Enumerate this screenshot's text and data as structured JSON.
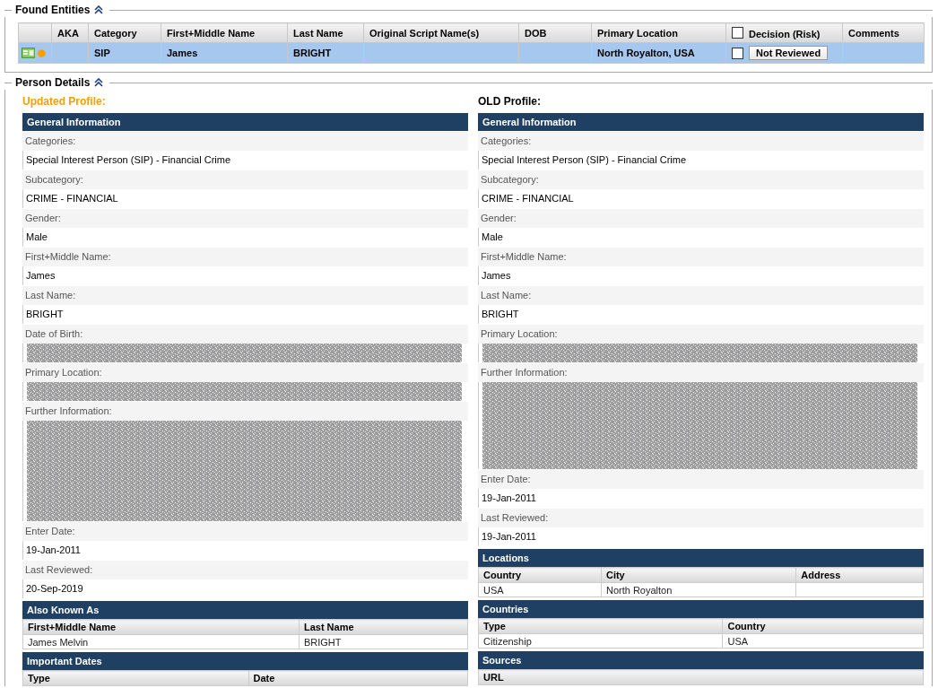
{
  "found_entities": {
    "title": "Found Entities",
    "columns": [
      "AKA",
      "Category",
      "First+Middle Name",
      "Last Name",
      "Original Script Name(s)",
      "DOB",
      "Primary Location",
      "Decision (Risk)",
      "Comments"
    ],
    "header_checkbox": {
      "checked": false
    },
    "rows": [
      {
        "selected": true,
        "category": "SIP",
        "first_middle_name": "James",
        "last_name": "BRIGHT",
        "primary_location": "North Royalton, USA",
        "decision_checkbox": {
          "checked": false
        },
        "decision": "Not Reviewed"
      }
    ]
  },
  "person_details": {
    "title": "Person Details",
    "profiles": [
      {
        "kind": "updated",
        "heading": "Updated Profile:",
        "sections": [
          {
            "kind": "fields",
            "title": "General Information",
            "fields": [
              {
                "kind": "text",
                "label": "Categories:",
                "value": "Special Interest Person (SIP) - Financial Crime"
              },
              {
                "kind": "text",
                "label": "Subcategory:",
                "value": "CRIME - FINANCIAL"
              },
              {
                "kind": "text",
                "label": "Gender:",
                "value": "Male"
              },
              {
                "kind": "text",
                "label": "First+Middle Name:",
                "value": "James"
              },
              {
                "kind": "text",
                "label": "Last Name:",
                "value": "BRIGHT"
              },
              {
                "kind": "redacted",
                "label": "Date of Birth:"
              },
              {
                "kind": "redacted",
                "label": "Primary Location:"
              },
              {
                "kind": "redacted_tall",
                "label": "Further Information:"
              },
              {
                "kind": "text",
                "label": "Enter Date:",
                "value": "19-Jan-2011"
              },
              {
                "kind": "text",
                "label": "Last Reviewed:",
                "value": "20-Sep-2019"
              }
            ]
          },
          {
            "kind": "table",
            "title": "Also Known As",
            "columns": [
              "First+Middle Name",
              "Last Name"
            ],
            "rows": [
              [
                "James Melvin",
                "BRIGHT"
              ]
            ]
          },
          {
            "kind": "table",
            "title": "Important Dates",
            "columns": [
              "Type",
              "Date"
            ]
          }
        ]
      },
      {
        "kind": "old",
        "heading": "OLD Profile:",
        "sections": [
          {
            "kind": "fields",
            "title": "General Information",
            "fields": [
              {
                "kind": "text",
                "label": "Categories:",
                "value": "Special Interest Person (SIP) - Financial Crime"
              },
              {
                "kind": "text",
                "label": "Subcategory:",
                "value": "CRIME - FINANCIAL"
              },
              {
                "kind": "text",
                "label": "Gender:",
                "value": "Male"
              },
              {
                "kind": "text",
                "label": "First+Middle Name:",
                "value": "James"
              },
              {
                "kind": "text",
                "label": "Last Name:",
                "value": "BRIGHT"
              },
              {
                "kind": "redacted",
                "label": "Primary Location:"
              },
              {
                "kind": "redacted_block",
                "label": "Further Information:"
              },
              {
                "kind": "text",
                "label": "Enter Date:",
                "value": "19-Jan-2011"
              },
              {
                "kind": "text",
                "label": "Last Reviewed:",
                "value": "19-Jan-2011"
              }
            ]
          },
          {
            "kind": "table",
            "title": "Locations",
            "columns": [
              "Country",
              "City",
              "Address"
            ],
            "rows": [
              [
                "USA",
                "North Royalton",
                ""
              ]
            ]
          },
          {
            "kind": "table",
            "title": "Countries",
            "columns": [
              "Type",
              "Country"
            ],
            "rows": [
              [
                "Citizenship",
                "USA"
              ]
            ]
          },
          {
            "kind": "table",
            "title": "Sources",
            "columns": [
              "URL"
            ]
          }
        ]
      }
    ]
  }
}
